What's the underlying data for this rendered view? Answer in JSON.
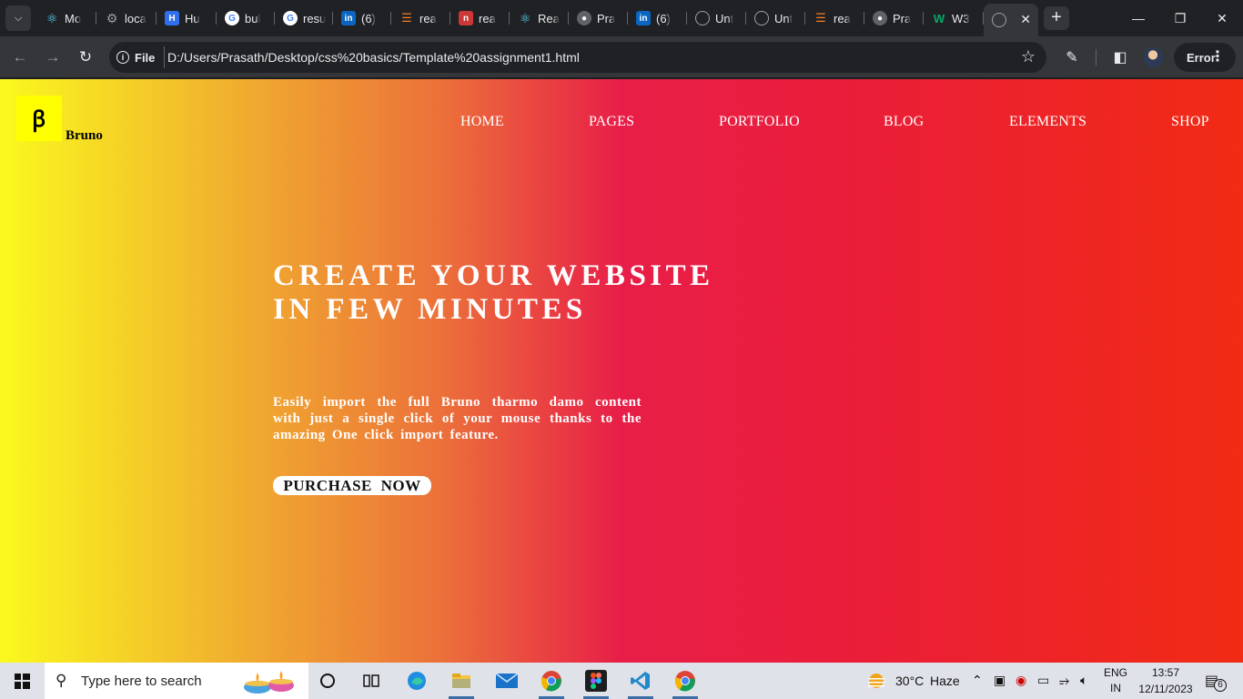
{
  "browser": {
    "tabs": [
      {
        "title": "Mo",
        "favicon": "react-icon",
        "color": "#61dafb"
      },
      {
        "title": "loca",
        "favicon": "gear-icon",
        "color": "#9aa0a6"
      },
      {
        "title": "Hu",
        "favicon": "hackerrank-icon",
        "color": "#2f6fed"
      },
      {
        "title": "bul",
        "favicon": "google-icon",
        "color": "#ffffff"
      },
      {
        "title": "resu",
        "favicon": "google-icon",
        "color": "#ffffff"
      },
      {
        "title": "(6)",
        "favicon": "linkedin-icon",
        "color": "#0a66c2"
      },
      {
        "title": "rea",
        "favicon": "stackoverflow-icon",
        "color": "#f48024"
      },
      {
        "title": "rea",
        "favicon": "npm-icon",
        "color": "#cb3837"
      },
      {
        "title": "Rea",
        "favicon": "react-icon",
        "color": "#61dafb"
      },
      {
        "title": "Pra",
        "favicon": "github-icon",
        "color": "#9aa0a6"
      },
      {
        "title": "(6)",
        "favicon": "linkedin-icon",
        "color": "#0a66c2"
      },
      {
        "title": "Unt",
        "favicon": "globe-icon",
        "color": "#9aa0a6"
      },
      {
        "title": "Unt",
        "favicon": "globe-icon",
        "color": "#9aa0a6"
      },
      {
        "title": "rea",
        "favicon": "stackoverflow-icon",
        "color": "#f48024"
      },
      {
        "title": "Pra",
        "favicon": "github-icon",
        "color": "#9aa0a6"
      },
      {
        "title": "W3",
        "favicon": "w3schools-icon",
        "color": "#04aa6d"
      },
      {
        "title": "",
        "favicon": "globe-icon",
        "color": "#9aa0a6",
        "active": true
      }
    ],
    "file_label": "File",
    "url": "D:/Users/Prasath/Desktop/css%20basics/Template%20assignment1.html",
    "error_label": "Error"
  },
  "page": {
    "logo_glyph": "ꞵ",
    "brand": "Bruno",
    "nav": [
      "HOME",
      "PAGES",
      "PORTFOLIO",
      "BLOG",
      "ELEMENTS",
      "SHOP"
    ],
    "hero_title_line1": "CREATE YOUR WEBSITE",
    "hero_title_line2": "IN FEW MINUTES",
    "hero_text": "Easily import the full Bruno tharmo damo content with just a single click of your mouse thanks to the amazing One click import feature.",
    "cta": "PURCHASE NOW",
    "gradient": [
      "#faf91e",
      "#eb6e3a",
      "#e81e48",
      "#f12b14"
    ]
  },
  "taskbar": {
    "search_placeholder": "Type here to search",
    "weather_temp": "30°C",
    "weather_desc": "Haze",
    "lang_line1": "ENG",
    "lang_line2": "IN",
    "time": "13:57",
    "date": "12/11/2023",
    "notification_count": "6"
  }
}
